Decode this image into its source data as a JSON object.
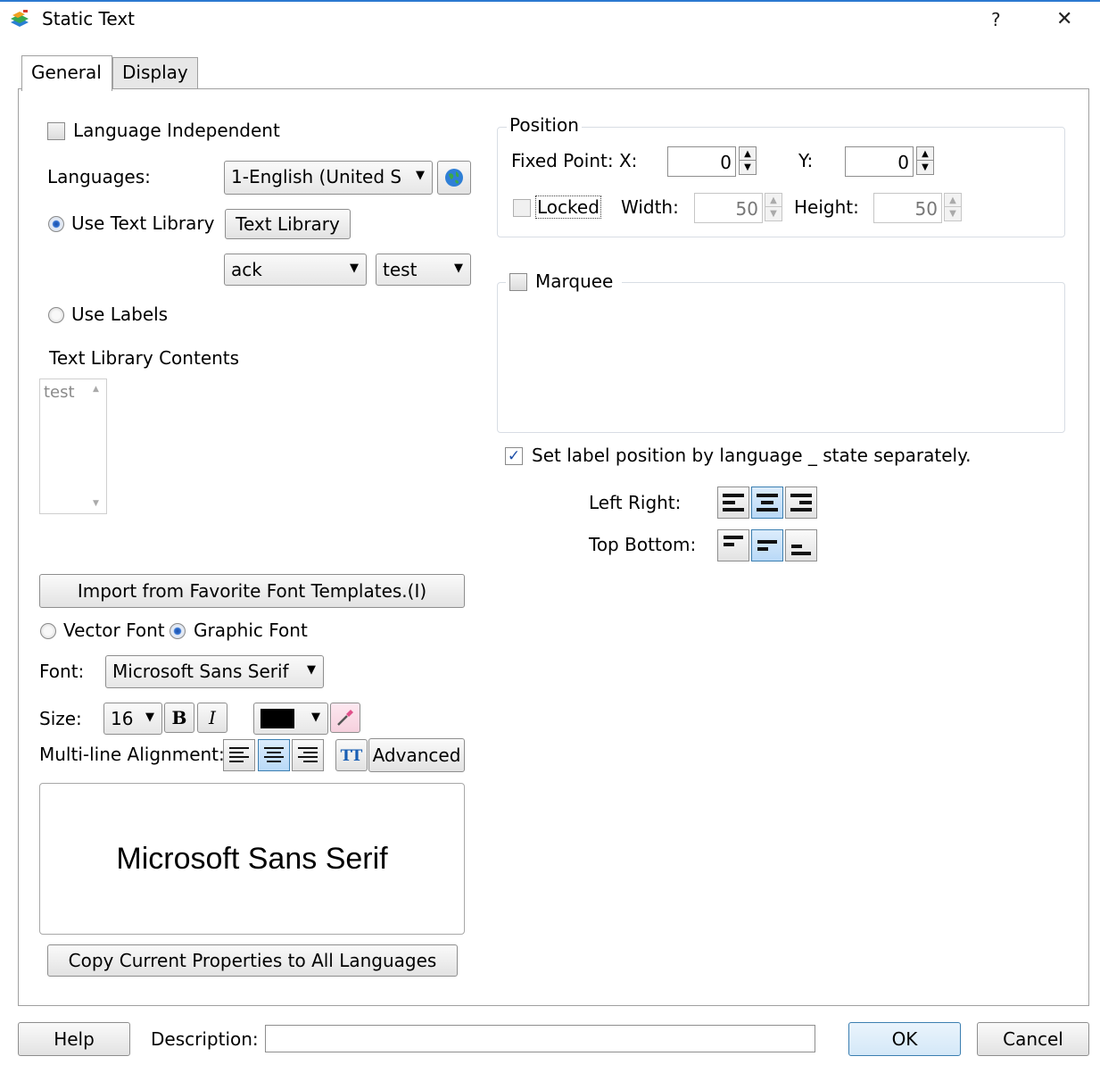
{
  "window": {
    "title": "Static Text",
    "help_glyph": "?",
    "close_glyph": "✕"
  },
  "tabs": [
    {
      "label": "General"
    },
    {
      "label": "Display"
    }
  ],
  "general": {
    "language_independent": "Language Independent",
    "languages_label": "Languages:",
    "languages_value": "1-English (United S",
    "use_text_library": "Use Text Library",
    "text_library_button": "Text Library",
    "library_combo": "ack",
    "text_combo": "test",
    "use_labels": "Use Labels",
    "contents_label": "Text Library Contents",
    "contents_items": [
      "test"
    ],
    "import_button": "Import from Favorite Font Templates.(I)",
    "vector_font": "Vector Font",
    "graphic_font": "Graphic Font",
    "font_label": "Font:",
    "font_value": "Microsoft Sans Serif",
    "size_label": "Size:",
    "size_value": "16",
    "bold_glyph": "B",
    "italic_glyph": "I",
    "text_color": "#000000",
    "multiline_label": "Multi-line Alignment:",
    "advanced_button": "Advanced",
    "tt_glyph": "TT",
    "preview_text": "Microsoft Sans Serif",
    "copy_button": "Copy Current Properties to All Languages"
  },
  "position": {
    "group_title": "Position",
    "fixed_point_label": "Fixed Point: X:",
    "x_value": "0",
    "y_label": "Y:",
    "y_value": "0",
    "locked_label": "Locked",
    "width_label": "Width:",
    "width_value": "50",
    "height_label": "Height:",
    "height_value": "50"
  },
  "marquee": {
    "label": "Marquee"
  },
  "label_position": {
    "checkbox_label": "Set label position by language _ state separately.",
    "left_right_label": "Left Right:",
    "top_bottom_label": "Top Bottom:"
  },
  "footer": {
    "help_button": "Help",
    "description_label": "Description:",
    "description_value": "",
    "ok_button": "OK",
    "cancel_button": "Cancel"
  }
}
